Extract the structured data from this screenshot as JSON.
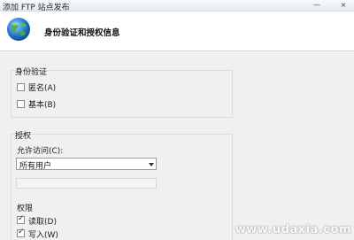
{
  "window": {
    "title": "添加 FTP 站点发布",
    "minimize_glyph": "—",
    "close_glyph": "×"
  },
  "header": {
    "title": "身份验证和授权信息",
    "icon": "globe-icon"
  },
  "authentication": {
    "group_label": "身份验证",
    "options": [
      {
        "label": "匿名(A)",
        "checked": false
      },
      {
        "label": "基本(B)",
        "checked": false
      }
    ]
  },
  "authorization": {
    "group_label": "授权",
    "access_label": "允许访问(C):",
    "access_value": "所有用户",
    "access_field_value": ""
  },
  "permissions": {
    "group_label": "权限",
    "options": [
      {
        "label": "读取(D)",
        "checked": true
      },
      {
        "label": "写入(W)",
        "checked": true
      }
    ]
  },
  "watermark": "www.udaxia.com"
}
